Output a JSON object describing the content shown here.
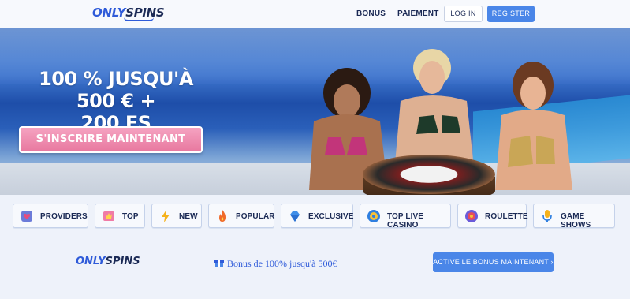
{
  "header": {
    "logo_only": "ONLY",
    "logo_spins": "SPINS",
    "nav": [
      {
        "label": "BONUS"
      },
      {
        "label": "PAIEMENT"
      }
    ],
    "login_label": "LOG IN",
    "register_label": "REGISTER"
  },
  "hero": {
    "title_line1": "100 % JUSQU'À 500 € +",
    "title_line2": "200 FS",
    "cta_label": "S'INSCRIRE MAINTENANT"
  },
  "categories": [
    {
      "label": "PROVIDERS",
      "icon": "providers-icon"
    },
    {
      "label": "TOP",
      "icon": "top-icon"
    },
    {
      "label": "NEW",
      "icon": "lightning-icon"
    },
    {
      "label": "POPULAR",
      "icon": "fire-icon"
    },
    {
      "label": "EXCLUSIVE",
      "icon": "diamond-icon"
    },
    {
      "label": "TOP LIVE CASINO",
      "icon": "live-casino-icon"
    },
    {
      "label": "ROULETTE",
      "icon": "roulette-icon"
    },
    {
      "label": "GAME SHOWS",
      "icon": "microphone-icon"
    }
  ],
  "footer": {
    "logo_only": "ONLY",
    "logo_spins": "SPINS",
    "bonus_text": "Bonus de 100% jusqu'à 500€",
    "activate_label": "ACTIVE LE BONUS MAINTENANT ›"
  },
  "colors": {
    "accent": "#4a86e8",
    "brand_dark": "#1b2a55",
    "cta_pink": "#e8789f"
  }
}
